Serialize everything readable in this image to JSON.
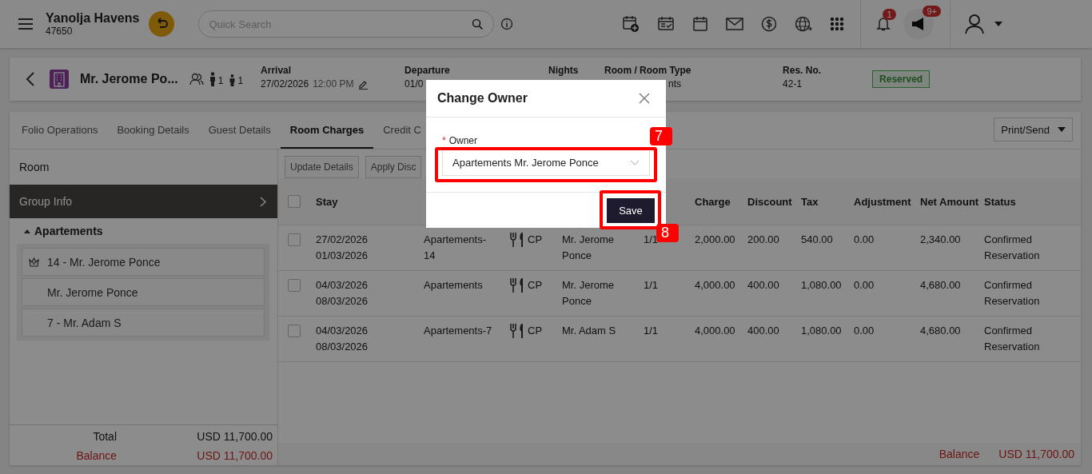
{
  "top_bar": {
    "hotel_name": "Yanolja Havens",
    "hotel_code": "47650",
    "search": {
      "placeholder": "Quick Search"
    },
    "notification_count": "1",
    "announcement_count": "9+"
  },
  "reservation": {
    "guest_name": "Mr. Jerome Po...",
    "adults": "1",
    "children": "1",
    "arrival_label": "Arrival",
    "arrival_date": "27/02/2026",
    "arrival_time": "12:00 PM",
    "departure_label": "Departure",
    "departure_value": "01/0",
    "nights_label": "Nights",
    "room_label": "Room / Room Type",
    "room_value": "nts",
    "res_no_label": "Res. No.",
    "res_no": "42-1",
    "status": "Reserved"
  },
  "tabs": [
    {
      "label": "Folio Operations",
      "selected": false
    },
    {
      "label": "Booking Details",
      "selected": false
    },
    {
      "label": "Guest Details",
      "selected": false
    },
    {
      "label": "Room Charges",
      "selected": true
    },
    {
      "label": "Credit C",
      "selected": false
    }
  ],
  "print_button": "Print/Send",
  "sidebar": {
    "room_label": "Room",
    "group_info": "Group Info",
    "group_name": "Apartements",
    "expanded": true,
    "items": [
      {
        "label": "14 - Mr. Jerome Ponce",
        "kind": "master"
      },
      {
        "label": "Mr. Jerome Ponce",
        "kind": "guest"
      },
      {
        "label": "7 - Mr. Adam S",
        "kind": "guest"
      }
    ],
    "total_label": "Total",
    "total": "USD 11,700.00",
    "balance_label": "Balance",
    "balance": "USD 11,700.00"
  },
  "toolbar": [
    "Update Details",
    "Apply Disc"
  ],
  "table": {
    "all_selected": false,
    "columns": [
      {
        "label": "Stay"
      },
      {
        "label": "Charge"
      },
      {
        "label": "Discount"
      },
      {
        "label": "Tax"
      },
      {
        "label": "Adjustment"
      },
      {
        "label": "Net Amount"
      },
      {
        "label": "Status"
      }
    ],
    "rows": [
      {
        "selected": false,
        "stay_from": "27/02/2026",
        "stay_to": "01/03/2026",
        "room": "Apartements-14",
        "meal_plan": "CP",
        "guest": "Mr. Jerome Ponce",
        "pax": "1/1",
        "charge": "2,000.00",
        "discount": "200.00",
        "tax": "540.00",
        "adjustment": "0.00",
        "net_amount": "2,340.00",
        "status": "Confirmed Reservation"
      },
      {
        "selected": false,
        "stay_from": "04/03/2026",
        "stay_to": "08/03/2026",
        "room": "Apartements",
        "meal_plan": "CP",
        "guest": "Mr. Jerome Ponce",
        "pax": "1/1",
        "charge": "4,000.00",
        "discount": "400.00",
        "tax": "1,080.00",
        "adjustment": "0.00",
        "net_amount": "4,680.00",
        "status": "Confirmed Reservation"
      },
      {
        "selected": false,
        "stay_from": "04/03/2026",
        "stay_to": "08/03/2026",
        "room": "Apartements-7",
        "meal_plan": "CP",
        "guest": "Mr. Adam S",
        "pax": "1/1",
        "charge": "4,000.00",
        "discount": "400.00",
        "tax": "1,080.00",
        "adjustment": "0.00",
        "net_amount": "4,680.00",
        "status": "Confirmed Reservation"
      }
    ]
  },
  "footer": {
    "balance_label": "Balance",
    "balance": "USD 11,700.00"
  },
  "dialog": {
    "title": "Change Owner",
    "owner_label": "Owner",
    "required_mark": "*",
    "owner_value": "Apartements Mr. Jerome Ponce",
    "save": "Save"
  },
  "annotations": [
    {
      "label": "7"
    },
    {
      "label": "8"
    }
  ]
}
